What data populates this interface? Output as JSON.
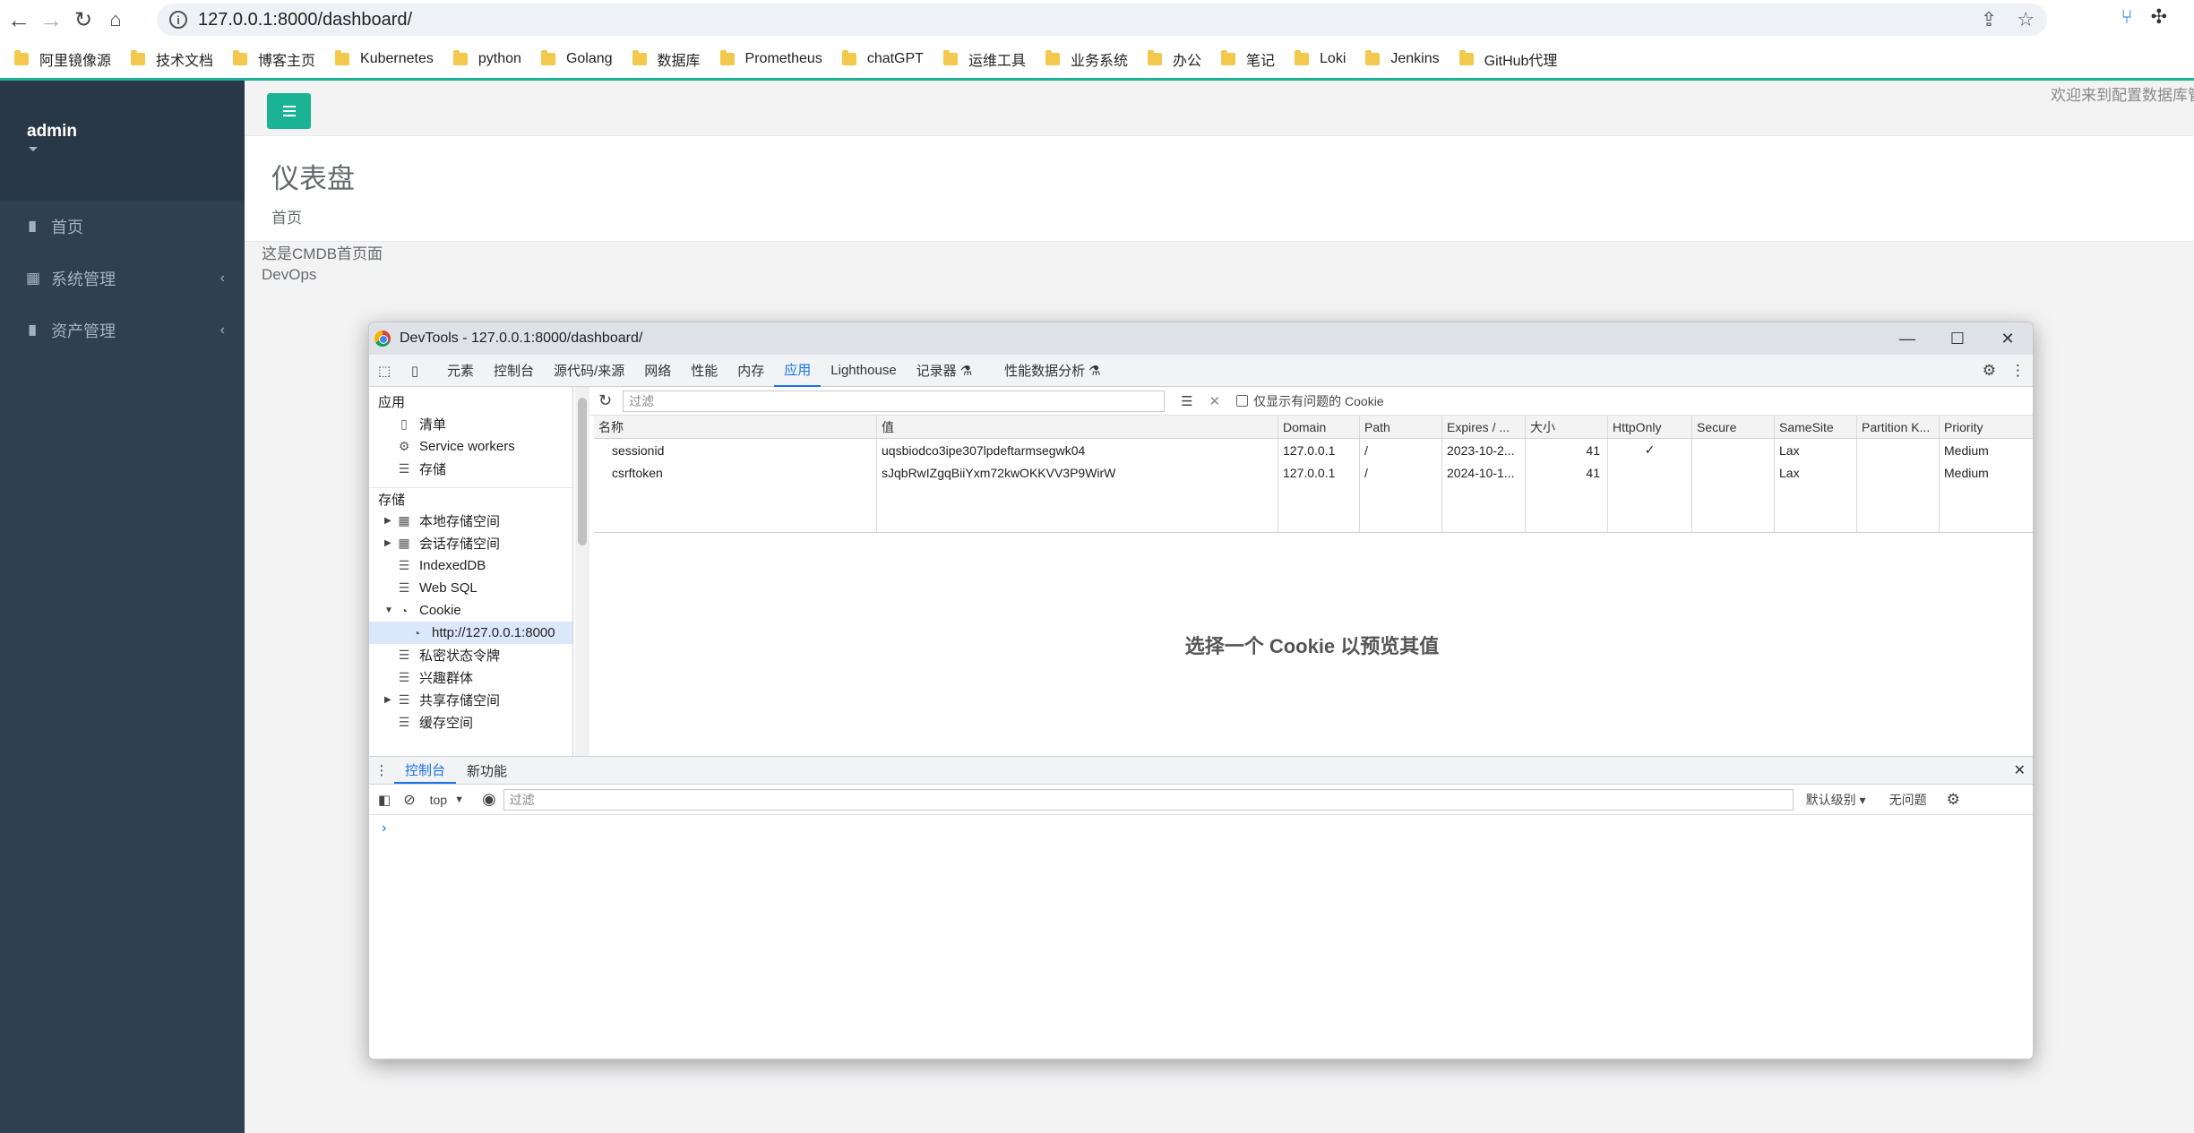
{
  "browser": {
    "url": "127.0.0.1:8000/dashboard/",
    "bookmarks": [
      "阿里镜像源",
      "技术文档",
      "博客主页",
      "Kubernetes",
      "python",
      "Golang",
      "数据库",
      "Prometheus",
      "chatGPT",
      "运维工具",
      "业务系统",
      "办公",
      "笔记",
      "Loki",
      "Jenkins",
      "GitHub代理"
    ]
  },
  "app": {
    "username": "admin",
    "menu": [
      {
        "label": "首页",
        "icon": "bar-chart-icon",
        "has_children": false
      },
      {
        "label": "系统管理",
        "icon": "grid-icon",
        "has_children": true
      },
      {
        "label": "资产管理",
        "icon": "bar-chart-icon",
        "has_children": true
      }
    ],
    "welcome_text": "欢迎来到配置数据库管",
    "page_title": "仪表盘",
    "breadcrumb": "首页",
    "content_lines": [
      "这是CMDB首页面",
      "DevOps"
    ]
  },
  "devtools": {
    "title": "DevTools - 127.0.0.1:8000/dashboard/",
    "tabs": [
      "元素",
      "控制台",
      "源代码/来源",
      "网络",
      "性能",
      "内存",
      "应用",
      "Lighthouse",
      "记录器",
      "性能数据分析"
    ],
    "active_tab": "应用",
    "tree": {
      "section_app": "应用",
      "app_items": [
        "清单",
        "Service workers",
        "存储"
      ],
      "section_storage": "存储",
      "storage_items": [
        "本地存储空间",
        "会话存储空间",
        "IndexedDB",
        "Web SQL",
        "Cookie",
        "http://127.0.0.1:8000",
        "私密状态令牌",
        "兴趣群体",
        "共享存储空间",
        "缓存空间"
      ]
    },
    "cookie_filter_placeholder": "过滤",
    "only_issues_label": "仅显示有问题的 Cookie",
    "columns": [
      "名称",
      "值",
      "Domain",
      "Path",
      "Expires / ...",
      "大小",
      "HttpOnly",
      "Secure",
      "SameSite",
      "Partition K...",
      "Priority"
    ],
    "cookies": [
      {
        "name": "sessionid",
        "value": "uqsbiodco3ipe307lpdeftarmsegwk04",
        "domain": "127.0.0.1",
        "path": "/",
        "expires": "2023-10-2...",
        "size": "41",
        "httponly": "✓",
        "secure": "",
        "samesite": "Lax",
        "partition": "",
        "priority": "Medium"
      },
      {
        "name": "csrftoken",
        "value": "sJqbRwIZgqBiiYxm72kwOKKVV3P9WirW",
        "domain": "127.0.0.1",
        "path": "/",
        "expires": "2024-10-1...",
        "size": "41",
        "httponly": "",
        "secure": "",
        "samesite": "Lax",
        "partition": "",
        "priority": "Medium"
      }
    ],
    "preview_message": "选择一个 Cookie 以预览其值",
    "drawer_tabs": [
      "控制台",
      "新功能"
    ],
    "console": {
      "context": "top",
      "filter_placeholder": "过滤",
      "level": "默认级别 ▾",
      "issues": "无问题"
    }
  },
  "colors": {
    "sidebar": "#2f4050",
    "accent": "#1ab394",
    "devtools_blue": "#1a73e8"
  }
}
